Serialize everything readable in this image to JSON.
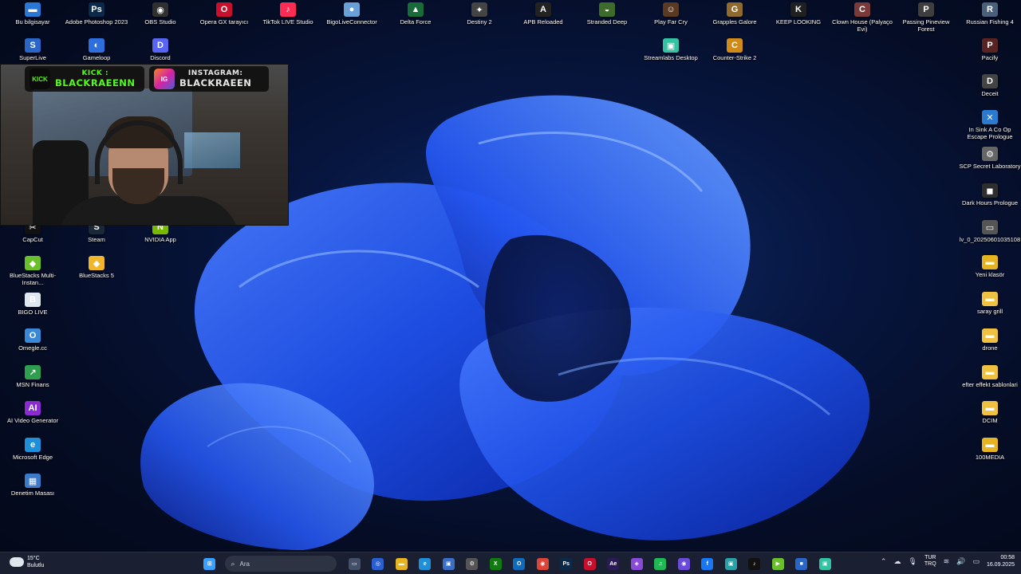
{
  "desktop": {
    "icons": [
      {
        "label": "Bu bilgisayar",
        "glyph": "▬",
        "color": "#2a78d6"
      },
      {
        "label": "Adobe Photoshop 2023",
        "glyph": "Ps",
        "color": "#0b2a4a"
      },
      {
        "label": "OBS Studio",
        "glyph": "◉",
        "color": "#303030"
      },
      {
        "label": "Opera GX tarayıcı",
        "glyph": "O",
        "color": "#c8102e"
      },
      {
        "label": "TikTok LIVE Studio",
        "glyph": "♪",
        "color": "#fe2c55"
      },
      {
        "label": "BigoLiveConnector",
        "glyph": "●",
        "color": "#6aa0d8"
      },
      {
        "label": "Delta Force",
        "glyph": "▲",
        "color": "#1a6b3a"
      },
      {
        "label": "Destiny 2",
        "glyph": "✦",
        "color": "#444"
      },
      {
        "label": "APB Reloaded",
        "glyph": "A",
        "color": "#222"
      },
      {
        "label": "Stranded Deep",
        "glyph": "◒",
        "color": "#3d6b2a"
      },
      {
        "label": "Play Far Cry",
        "glyph": "☺",
        "color": "#5a3a22"
      },
      {
        "label": "Grapples Galore",
        "glyph": "G",
        "color": "#8f6a2c"
      },
      {
        "label": "KEEP LOOKING",
        "glyph": "K",
        "color": "#202020"
      },
      {
        "label": "Clown House (Palyaço Evi)",
        "glyph": "C",
        "color": "#7a3a3a"
      },
      {
        "label": "Passing Pineview Forest",
        "glyph": "P",
        "color": "#3e3e3e"
      },
      {
        "label": "Russian Fishing 4",
        "glyph": "R",
        "color": "#4a607a"
      },
      {
        "label": "SuperLive",
        "glyph": "S",
        "color": "#2a66c8"
      },
      {
        "label": "Gameloop",
        "glyph": "◐",
        "color": "#2e6fe0"
      },
      {
        "label": "Discord",
        "glyph": "D",
        "color": "#5865f2"
      },
      {
        "label": "Streamlabs Desktop",
        "glyph": "▣",
        "color": "#31c3a2"
      },
      {
        "label": "Counter-Strike 2",
        "glyph": "C",
        "color": "#d08a1a"
      },
      {
        "label": "Pacify",
        "glyph": "P",
        "color": "#5a2323"
      },
      {
        "label": "Deceit",
        "glyph": "D",
        "color": "#444"
      },
      {
        "label": "In Sink A Co Op Escape Prologue",
        "glyph": "✕",
        "color": "#2a7ad0"
      },
      {
        "label": "SCP Secret Laboratory",
        "glyph": "⚙",
        "color": "#666"
      },
      {
        "label": "Dark Hours Prologue",
        "glyph": "◼",
        "color": "#2e2e2e"
      },
      {
        "label": "lv_0_20250601035108",
        "glyph": "▭",
        "color": "#555"
      },
      {
        "label": "Yeni klasör",
        "glyph": "▬",
        "color": "#e6b422"
      },
      {
        "label": "saray grill",
        "glyph": "▬",
        "color": "#f0c040"
      },
      {
        "label": "drone",
        "glyph": "▬",
        "color": "#f0c040"
      },
      {
        "label": "efter effekt sablonlari",
        "glyph": "▬",
        "color": "#f0c040"
      },
      {
        "label": "DCIM",
        "glyph": "▬",
        "color": "#f0c040"
      },
      {
        "label": "100MEDIA",
        "glyph": "▬",
        "color": "#e6b422"
      },
      {
        "label": "CapCut",
        "glyph": "✂",
        "color": "#111"
      },
      {
        "label": "Steam",
        "glyph": "S",
        "color": "#1b2838"
      },
      {
        "label": "NVIDIA App",
        "glyph": "N",
        "color": "#76b900"
      },
      {
        "label": "BlueStacks Multi-Instan...",
        "glyph": "◆",
        "color": "#6bbf2a"
      },
      {
        "label": "BlueStacks 5",
        "glyph": "◆",
        "color": "#f2b62a"
      },
      {
        "label": "BIGO LIVE",
        "glyph": "B",
        "color": "#dfe6ee"
      },
      {
        "label": "Omegle.cc",
        "glyph": "O",
        "color": "#3a88d8"
      },
      {
        "label": "MSN Finans",
        "glyph": "↗",
        "color": "#2e9e4f"
      },
      {
        "label": "AI Video Generator",
        "glyph": "AI",
        "color": "#8a2ad0"
      },
      {
        "label": "Microsoft Edge",
        "glyph": "e",
        "color": "#1e8fd8"
      },
      {
        "label": "Denetim Masası",
        "glyph": "▦",
        "color": "#3a7ac8"
      }
    ]
  },
  "webcam": {
    "kick": {
      "line1": "KICK :",
      "line2": "BLACKRAEENN",
      "icon": "KICK",
      "color": "#53fc18"
    },
    "instagram": {
      "line1": "INSTAGRAM:",
      "line2": "BLACKRAEEN",
      "icon": "IG",
      "color": "#d6249f"
    }
  },
  "taskbar": {
    "weather": {
      "temp": "15°C",
      "condition": "Bulutlu"
    },
    "search_placeholder": "Ara",
    "apps": [
      {
        "name": "start-icon",
        "glyph": "⊞",
        "color": "#3aa0ff"
      },
      {
        "name": "task-view-icon",
        "glyph": "▭",
        "color": "#44506a"
      },
      {
        "name": "copilot-icon",
        "glyph": "◎",
        "color": "#2a5fd0"
      },
      {
        "name": "file-explorer-icon",
        "glyph": "▬",
        "color": "#e6b422"
      },
      {
        "name": "edge-icon",
        "glyph": "e",
        "color": "#1e8fd8"
      },
      {
        "name": "store-icon",
        "glyph": "▣",
        "color": "#3a6fc8"
      },
      {
        "name": "settings-icon",
        "glyph": "⚙",
        "color": "#555"
      },
      {
        "name": "xbox-icon",
        "glyph": "X",
        "color": "#107c10"
      },
      {
        "name": "outlook-icon",
        "glyph": "O",
        "color": "#0f6cbd"
      },
      {
        "name": "chrome-icon",
        "glyph": "◉",
        "color": "#db4437"
      },
      {
        "name": "photoshop-icon",
        "glyph": "Ps",
        "color": "#0b2a4a"
      },
      {
        "name": "opera-gx-icon",
        "glyph": "O",
        "color": "#c8102e"
      },
      {
        "name": "after-effects-icon",
        "glyph": "Ae",
        "color": "#2a1a55"
      },
      {
        "name": "copilot-app-icon",
        "glyph": "◈",
        "color": "#8a4ad8"
      },
      {
        "name": "spotify-icon",
        "glyph": "♫",
        "color": "#1db954"
      },
      {
        "name": "obs-icon",
        "glyph": "◉",
        "color": "#6a4ad8"
      },
      {
        "name": "facebook-icon",
        "glyph": "f",
        "color": "#1877f2"
      },
      {
        "name": "monitor-app-icon",
        "glyph": "▣",
        "color": "#2aa0a8"
      },
      {
        "name": "tiktok-icon",
        "glyph": "♪",
        "color": "#111"
      },
      {
        "name": "media-player-icon",
        "glyph": "▶",
        "color": "#6bbf2a"
      },
      {
        "name": "camera-app-icon",
        "glyph": "■",
        "color": "#2a66c8"
      },
      {
        "name": "streamlabs-icon",
        "glyph": "▣",
        "color": "#31c3a2"
      }
    ],
    "tray": {
      "lang_top": "TUR",
      "lang_bottom": "TRQ",
      "time": "00:58",
      "date": "16.09.2025"
    }
  }
}
